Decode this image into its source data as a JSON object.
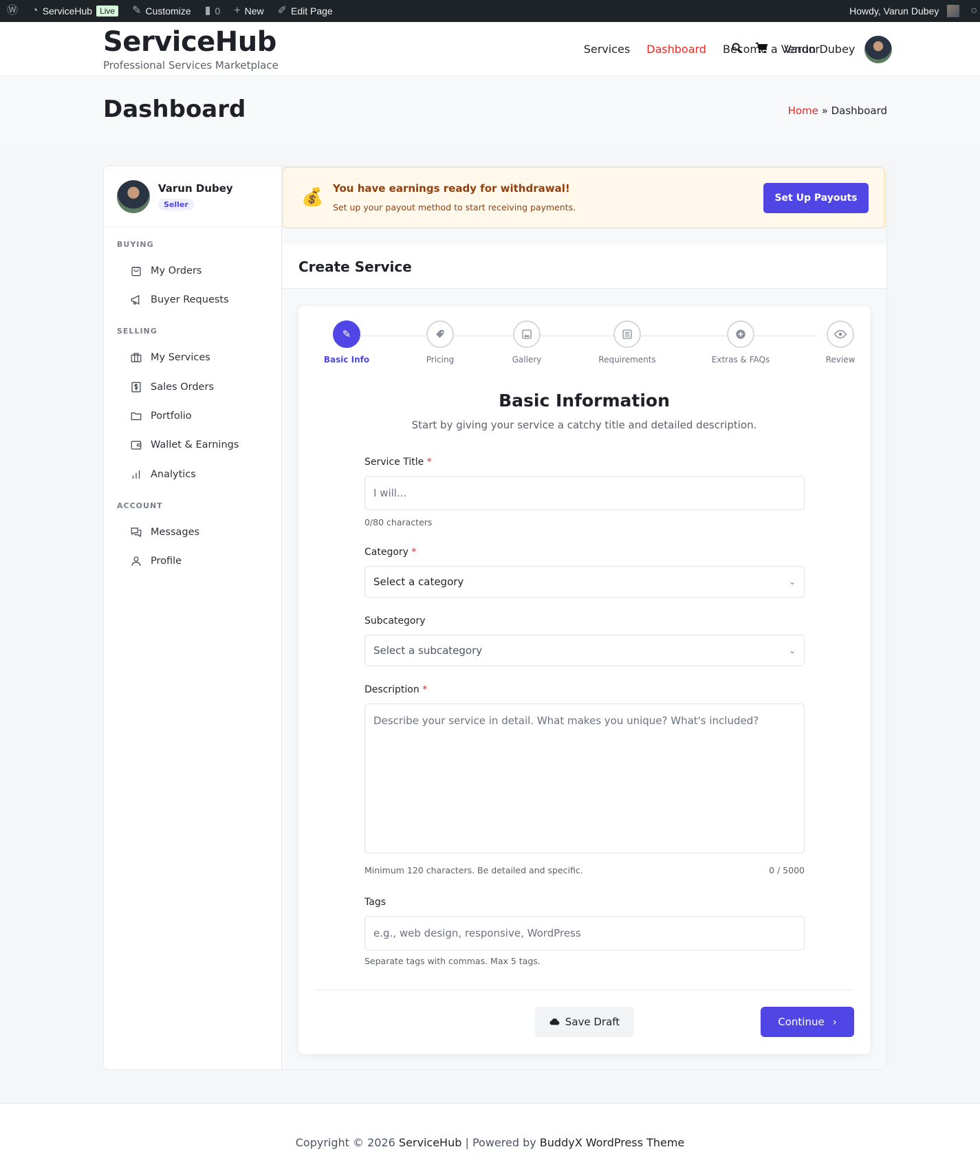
{
  "adminbar": {
    "site_name": "ServiceHub",
    "live_badge": "Live",
    "customize": "Customize",
    "comments_count": "0",
    "new": "New",
    "edit_page": "Edit Page",
    "howdy": "Howdy, Varun Dubey"
  },
  "header": {
    "brand": "ServiceHub",
    "tagline": "Professional Services Marketplace",
    "nav": [
      "Services",
      "Dashboard",
      "Become a Vendor"
    ],
    "user_name": "Varun Dubey"
  },
  "titleband": {
    "title": "Dashboard",
    "breadcrumb_home": "Home",
    "breadcrumb_sep": "»",
    "breadcrumb_current": "Dashboard"
  },
  "sidebar": {
    "name": "Varun Dubey",
    "badge": "Seller",
    "sections": {
      "buying": "BUYING",
      "selling": "SELLING",
      "account": "ACCOUNT"
    },
    "items": {
      "my_orders": "My Orders",
      "buyer_requests": "Buyer Requests",
      "my_services": "My Services",
      "sales_orders": "Sales Orders",
      "portfolio": "Portfolio",
      "wallet": "Wallet & Earnings",
      "analytics": "Analytics",
      "messages": "Messages",
      "profile": "Profile"
    }
  },
  "alert": {
    "title": "You have earnings ready for withdrawal!",
    "subtitle": "Set up your payout method to start receiving payments.",
    "button": "Set Up Payouts"
  },
  "create_service": {
    "title": "Create Service",
    "steps": [
      "Basic Info",
      "Pricing",
      "Gallery",
      "Requirements",
      "Extras & FAQs",
      "Review"
    ],
    "section_title": "Basic Information",
    "section_subtitle": "Start by giving your service a catchy title and detailed description.",
    "fields": {
      "service_title_label": "Service Title",
      "service_title_placeholder": "I will...",
      "service_title_help": "0/80 characters",
      "category_label": "Category",
      "category_value": "Select a category",
      "subcategory_label": "Subcategory",
      "subcategory_value": "Select a subcategory",
      "description_label": "Description",
      "description_placeholder": "Describe your service in detail. What makes you unique? What's included?",
      "description_help": "Minimum 120 characters. Be detailed and specific.",
      "description_count": "0 / 5000",
      "tags_label": "Tags",
      "tags_placeholder": "e.g., web design, responsive, WordPress",
      "tags_help": "Separate tags with commas. Max 5 tags."
    },
    "required_mark": "*",
    "save_draft": "Save Draft",
    "continue": "Continue"
  },
  "footer": {
    "copyright": "Copyright © 2026",
    "site": "ServiceHub",
    "sep": "|",
    "powered": "Powered by",
    "theme": "BuddyX WordPress Theme"
  },
  "colors": {
    "accent": "#4f46e5",
    "nav_active": "#e02b27",
    "alert_bg": "#fff8eb",
    "alert_text": "#92400e"
  }
}
